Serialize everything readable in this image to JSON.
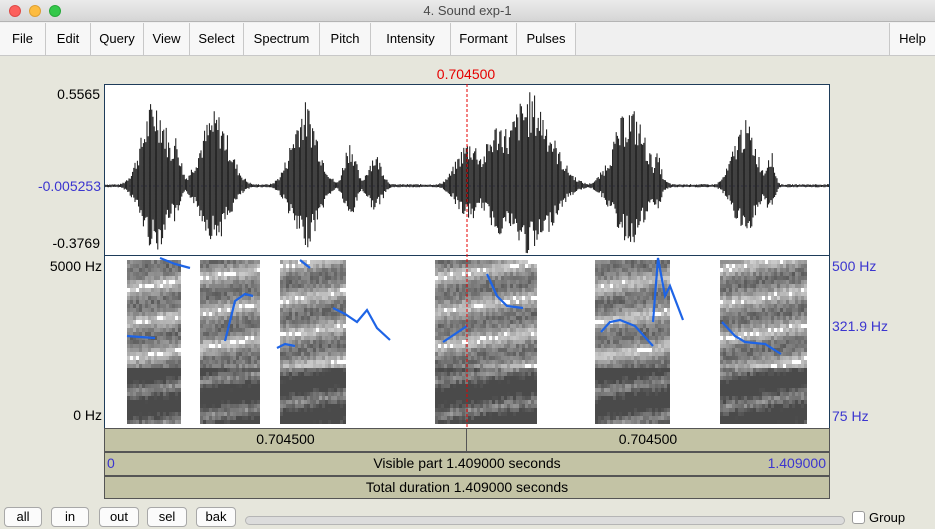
{
  "window": {
    "title": "4. Sound exp-1"
  },
  "menu": [
    "File",
    "Edit",
    "Query",
    "View",
    "Select",
    "Spectrum",
    "Pitch",
    "Intensity",
    "Formant",
    "Pulses"
  ],
  "help": "Help",
  "cursor": {
    "time_label": "0.704500"
  },
  "waveform": {
    "max_label": "0.5565",
    "mid_label": "-0.005253",
    "min_label": "-0.3769"
  },
  "spectrogram": {
    "top_freq_label": "5000 Hz",
    "bottom_freq_label": "0 Hz"
  },
  "pitch": {
    "top_label": "500 Hz",
    "mid_label": "321.9 Hz",
    "bottom_label": "75 Hz"
  },
  "time_bar": {
    "left_label": "0.704500",
    "right_label": "0.704500"
  },
  "visible_bar": {
    "start": "0",
    "text": "Visible part 1.409000 seconds",
    "end": "1.409000"
  },
  "total_bar": {
    "text": "Total duration 1.409000 seconds"
  },
  "buttons": [
    "all",
    "in",
    "out",
    "sel",
    "bak"
  ],
  "group": {
    "label": "Group",
    "checked": false
  },
  "colors": {
    "cursor": "#e60000",
    "pitch_curve": "#1e64e6",
    "axis_blue": "#3b35cf"
  }
}
